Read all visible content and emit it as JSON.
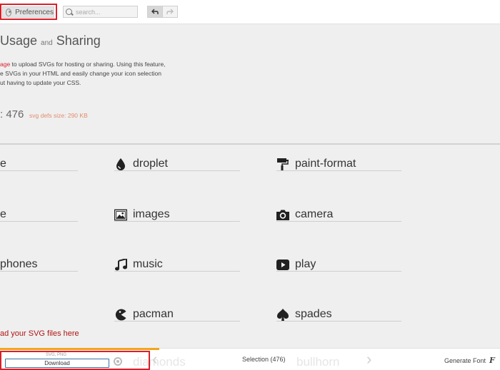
{
  "toolbar": {
    "preferences_label": "Preferences",
    "search_placeholder": "search...",
    "undo_icon": "undo-icon",
    "redo_icon": "redo-icon"
  },
  "heading": {
    "main": "Usage",
    "and": "and",
    "sharing": "Sharing"
  },
  "description": {
    "link_fragment": "age",
    "line1_rest": " to upload SVGs for hosting or sharing. Using this feature,",
    "line2": "e SVGs in your HTML and easily change your icon selection",
    "line3": "ut having to update your CSS."
  },
  "stats": {
    "count": ": 476",
    "defs_size": "svg defs size: 290 KB"
  },
  "glyphs": {
    "left": [
      "e",
      "e",
      "phones"
    ],
    "mid": [
      {
        "label": "droplet",
        "icon": "droplet-icon"
      },
      {
        "label": "images",
        "icon": "images-icon"
      },
      {
        "label": "music",
        "icon": "music-icon"
      },
      {
        "label": "pacman",
        "icon": "pacman-icon"
      }
    ],
    "right": [
      {
        "label": "paint-format",
        "icon": "paint-format-icon"
      },
      {
        "label": "camera",
        "icon": "camera-icon"
      },
      {
        "label": "play",
        "icon": "play-icon"
      },
      {
        "label": "spades",
        "icon": "spades-icon"
      }
    ]
  },
  "upload_text": "ad  your SVG files here",
  "bottom": {
    "format_label": "SVG, PNG",
    "download_label": "Download",
    "ghost_left": "diamonds",
    "ghost_right": "bullhorn",
    "selection_label": "Selection (476)",
    "generate_label": "Generate Font"
  },
  "colors": {
    "accent_red": "#d9202a",
    "orange_bar": "#f0a51e",
    "defs_text": "#e38c6d"
  }
}
